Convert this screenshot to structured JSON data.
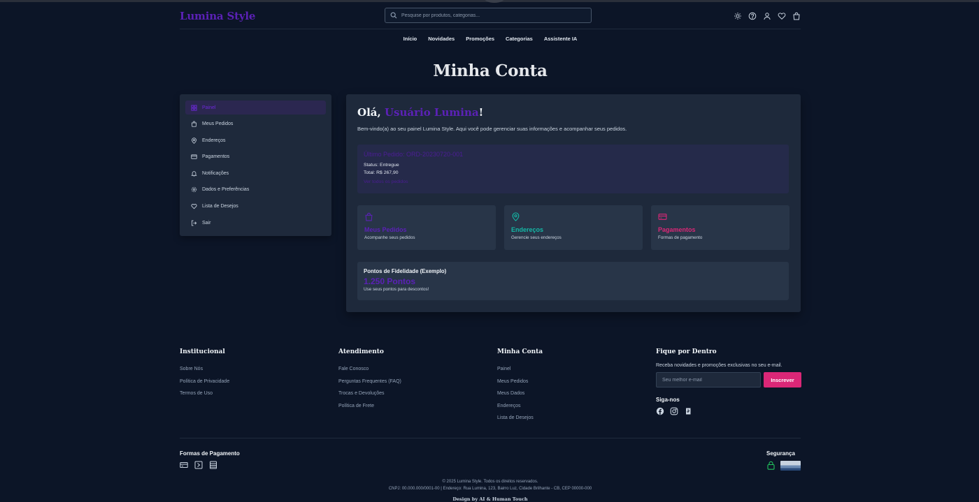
{
  "header": {
    "logo": "Lumina Style",
    "search_placeholder": "Pesquise por produtos, categorias...",
    "icons": [
      "sun-icon",
      "help-icon",
      "user-icon",
      "heart-icon",
      "bag-icon"
    ]
  },
  "nav": [
    "Início",
    "Novidades",
    "Promoções",
    "Categorias",
    "Assistente IA"
  ],
  "page_title": "Minha Conta",
  "sidebar": {
    "items": [
      {
        "label": "Painel",
        "icon": "dashboard-icon",
        "active": true
      },
      {
        "label": "Meus Pedidos",
        "icon": "bag-icon"
      },
      {
        "label": "Endereços",
        "icon": "map-pin-icon"
      },
      {
        "label": "Pagamentos",
        "icon": "credit-card-icon"
      },
      {
        "label": "Notificações",
        "icon": "bell-icon"
      },
      {
        "label": "Dados e Preferências",
        "icon": "gear-icon"
      },
      {
        "label": "Lista de Desejos",
        "icon": "heart-icon"
      },
      {
        "label": "Sair",
        "icon": "logout-icon"
      }
    ]
  },
  "dashboard": {
    "greeting_prefix": "Olá, ",
    "user_name": "Usuário Lumina",
    "greeting_suffix": "!",
    "welcome": "Bem-vindo(a) ao seu painel Lumina Style. Aqui você pode gerenciar suas informações e acompanhar seus pedidos.",
    "last_order": {
      "title": "Último Pedido: ORD-20230720-001",
      "status": "Status: Entregue",
      "total": "Total: R$ 267,90",
      "link": "Ver todos os pedidos"
    },
    "cards": [
      {
        "title": "Meus Pedidos",
        "subtitle": "Acompanhe seus pedidos",
        "icon": "bag-icon",
        "color": "#5b21b6"
      },
      {
        "title": "Endereços",
        "subtitle": "Gerencie seus endereços",
        "icon": "map-pin-icon",
        "color": "#14b8a6"
      },
      {
        "title": "Pagamentos",
        "subtitle": "Formas de pagamento",
        "icon": "credit-card-icon",
        "color": "#db2777"
      }
    ],
    "loyalty": {
      "title": "Pontos de Fidelidade (Exemplo)",
      "points": "1.250 Pontos",
      "subtitle": "Use seus pontos para descontos!"
    }
  },
  "footer": {
    "columns": [
      {
        "title": "Institucional",
        "links": [
          "Sobre Nós",
          "Política de Privacidade",
          "Termos de Uso"
        ]
      },
      {
        "title": "Atendimento",
        "links": [
          "Fale Conosco",
          "Perguntas Frequentes (FAQ)",
          "Trocas e Devoluções",
          "Política de Frete"
        ]
      },
      {
        "title": "Minha Conta",
        "links": [
          "Painel",
          "Meus Pedidos",
          "Meus Dados",
          "Endereços",
          "Lista de Desejos"
        ]
      }
    ],
    "newsletter": {
      "title": "Fique por Dentro",
      "description": "Receba novidades e promoções exclusivas no seu e-mail.",
      "placeholder": "Seu melhor e-mail",
      "button": "Inscrever",
      "follow": "Siga-nos",
      "socials": [
        "facebook-icon",
        "instagram-icon",
        "threads-icon"
      ]
    },
    "payment_title": "Formas de Pagamento",
    "payment_icons": [
      "credit-card-icon",
      "pix-icon",
      "boleto-icon"
    ],
    "security_title": "Segurança",
    "copyright": "© 2025 Lumina Style. Todos os direitos reservados.",
    "address": "CNPJ: 00.000.000/0001-00 | Endereço: Rua Lumina, 123, Bairro Luz, Cidade Brilhante - CB, CEP 00000-000",
    "design": "Design by AI & Human Touch"
  },
  "colors": {
    "background": "#0c1527",
    "panel": "#1e293b",
    "accent_purple": "#5b21b6",
    "accent_pink": "#db2777",
    "accent_teal": "#14b8a6"
  }
}
